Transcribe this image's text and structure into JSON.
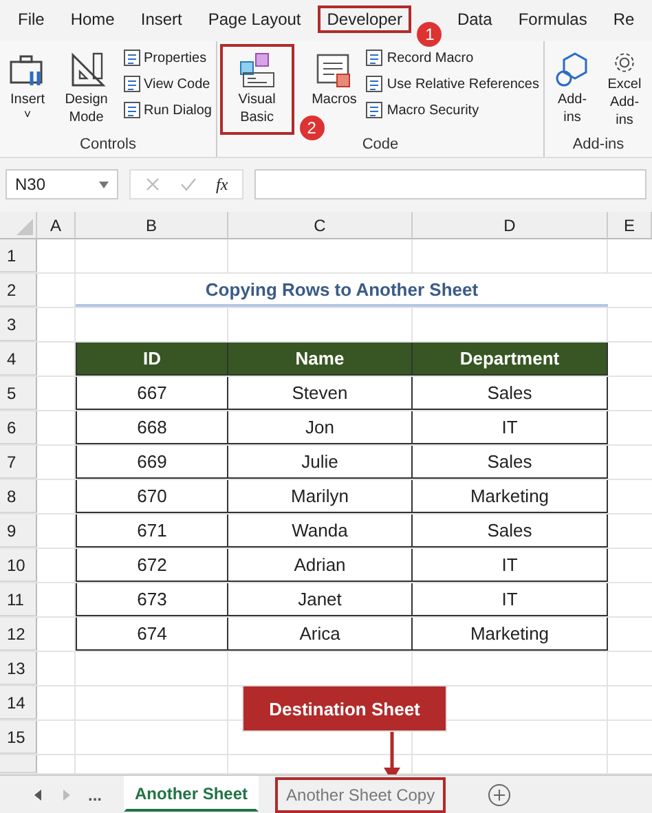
{
  "ribbon_tabs": [
    {
      "label": "File",
      "highlighted": false
    },
    {
      "label": "Home",
      "highlighted": false
    },
    {
      "label": "Insert",
      "highlighted": false
    },
    {
      "label": "Page Layout",
      "highlighted": false
    },
    {
      "label": "Developer",
      "highlighted": true,
      "badge": "1"
    },
    {
      "label": "Data",
      "highlighted": false
    },
    {
      "label": "Formulas",
      "highlighted": false
    },
    {
      "label": "Re",
      "highlighted": false
    }
  ],
  "ribbon_groups": [
    {
      "name": "Controls",
      "items": [
        {
          "kind": "large",
          "label": "Insert",
          "caret": "˅",
          "highlighted": false
        },
        {
          "kind": "large",
          "label": "Design Mode",
          "highlighted": false
        },
        {
          "kind": "small",
          "label": "Properties"
        },
        {
          "kind": "small",
          "label": "View Code"
        },
        {
          "kind": "small",
          "label": "Run Dialog"
        }
      ]
    },
    {
      "name": "Code",
      "items": [
        {
          "kind": "large",
          "label": "Visual Basic",
          "highlighted": true,
          "badge": "2"
        },
        {
          "kind": "large",
          "label": "Macros",
          "highlighted": false
        },
        {
          "kind": "small",
          "label": "Record Macro"
        },
        {
          "kind": "small",
          "label": "Use Relative References"
        },
        {
          "kind": "small",
          "label": "Macro Security"
        }
      ]
    },
    {
      "name": "Add-ins",
      "items": [
        {
          "kind": "large",
          "label": "Add-ins",
          "highlighted": false
        },
        {
          "kind": "large",
          "label": "Excel Add-ins",
          "highlighted": false
        }
      ]
    }
  ],
  "name_box": "N30",
  "function_label": "fx",
  "columns": [
    "A",
    "B",
    "C",
    "D",
    "E"
  ],
  "rows": [
    {
      "number": "1",
      "kind": "empty"
    },
    {
      "number": "2",
      "kind": "title",
      "text": "Copying Rows to Another Sheet"
    },
    {
      "number": "3",
      "kind": "empty"
    },
    {
      "number": "4",
      "kind": "header",
      "cells": [
        "ID",
        "Name",
        "Department"
      ]
    },
    {
      "number": "5",
      "kind": "data",
      "cells": [
        "667",
        "Steven",
        "Sales"
      ]
    },
    {
      "number": "6",
      "kind": "data",
      "cells": [
        "668",
        "Jon",
        "IT"
      ]
    },
    {
      "number": "7",
      "kind": "data",
      "cells": [
        "669",
        "Julie",
        "Sales"
      ]
    },
    {
      "number": "8",
      "kind": "data",
      "cells": [
        "670",
        "Marilyn",
        "Marketing"
      ]
    },
    {
      "number": "9",
      "kind": "data",
      "cells": [
        "671",
        "Wanda",
        "Sales"
      ]
    },
    {
      "number": "10",
      "kind": "data",
      "cells": [
        "672",
        "Adrian",
        "IT"
      ]
    },
    {
      "number": "11",
      "kind": "data",
      "cells": [
        "673",
        "Janet",
        "IT"
      ]
    },
    {
      "number": "12",
      "kind": "data",
      "cells": [
        "674",
        "Arica",
        "Marketing"
      ]
    },
    {
      "number": "13",
      "kind": "empty"
    },
    {
      "number": "14",
      "kind": "empty"
    },
    {
      "number": "15",
      "kind": "empty"
    }
  ],
  "callout": {
    "text": "Destination Sheet"
  },
  "sheet_overflow": "...",
  "sheet_tabs": [
    {
      "label": "Another Sheet",
      "selected": true,
      "highlighted": false
    },
    {
      "label": "Another Sheet Copy",
      "selected": false,
      "highlighted": true
    }
  ]
}
